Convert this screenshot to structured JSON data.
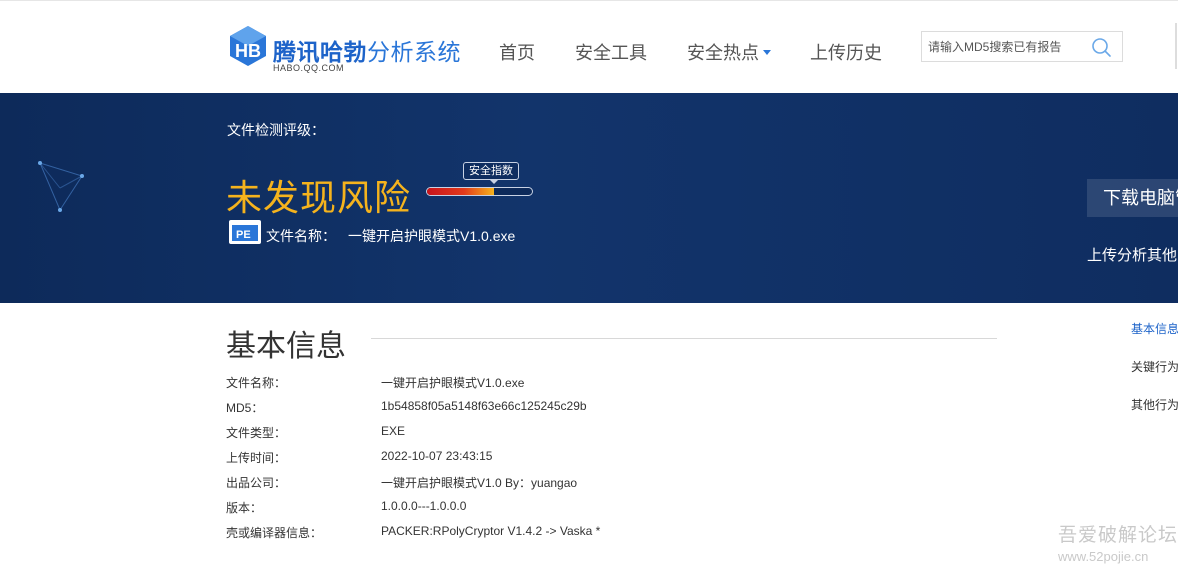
{
  "header": {
    "logo": {
      "title_bold": "腾讯哈勃",
      "title_light": "分析系统",
      "subtitle": "HABO.QQ.COM"
    },
    "nav": [
      {
        "label": "首页"
      },
      {
        "label": "安全工具"
      },
      {
        "label": "安全热点",
        "has_dropdown": true
      },
      {
        "label": "上传历史"
      }
    ],
    "search": {
      "placeholder": "请输入MD5搜索已有报告",
      "value": ""
    }
  },
  "banner": {
    "rating_label": "文件检测评级：",
    "verdict": "未发现风险",
    "safety_index_label": "安全指数",
    "safety_index_fill": 0.64,
    "file_name_label": "文件名称：",
    "file_name": "一键开启护眼模式V1.0.exe",
    "file_type_badge": "PE",
    "download_button": "下载电脑管",
    "upload_other": "上传分析其他"
  },
  "basic_info": {
    "title": "基本信息",
    "rows": [
      {
        "key": "文件名称：",
        "value": "一键开启护眼模式V1.0.exe"
      },
      {
        "key": "MD5：",
        "value": "1b54858f05a5148f63e66c125245c29b"
      },
      {
        "key": "文件类型：",
        "value": "EXE"
      },
      {
        "key": "上传时间：",
        "value": "2022-10-07 23:43:15"
      },
      {
        "key": "出品公司：",
        "value": "一键开启护眼模式V1.0 By：yuangao"
      },
      {
        "key": "版本：",
        "value": "1.0.0.0---1.0.0.0"
      },
      {
        "key": "壳或编译器信息：",
        "value": "PACKER:RPolyCryptor V1.4.2 -> Vaska *"
      }
    ]
  },
  "side_nav": [
    {
      "label": "基本信息",
      "active": true
    },
    {
      "label": "关键行为",
      "active": false
    },
    {
      "label": "其他行为",
      "active": false
    }
  ],
  "watermark": {
    "line1": "吾爱破解论坛",
    "line2": "www.52pojie.cn"
  },
  "colors": {
    "brand_blue": "#1d63c9",
    "banner_bg": "#12346b",
    "verdict_orange": "#f5b31d"
  }
}
